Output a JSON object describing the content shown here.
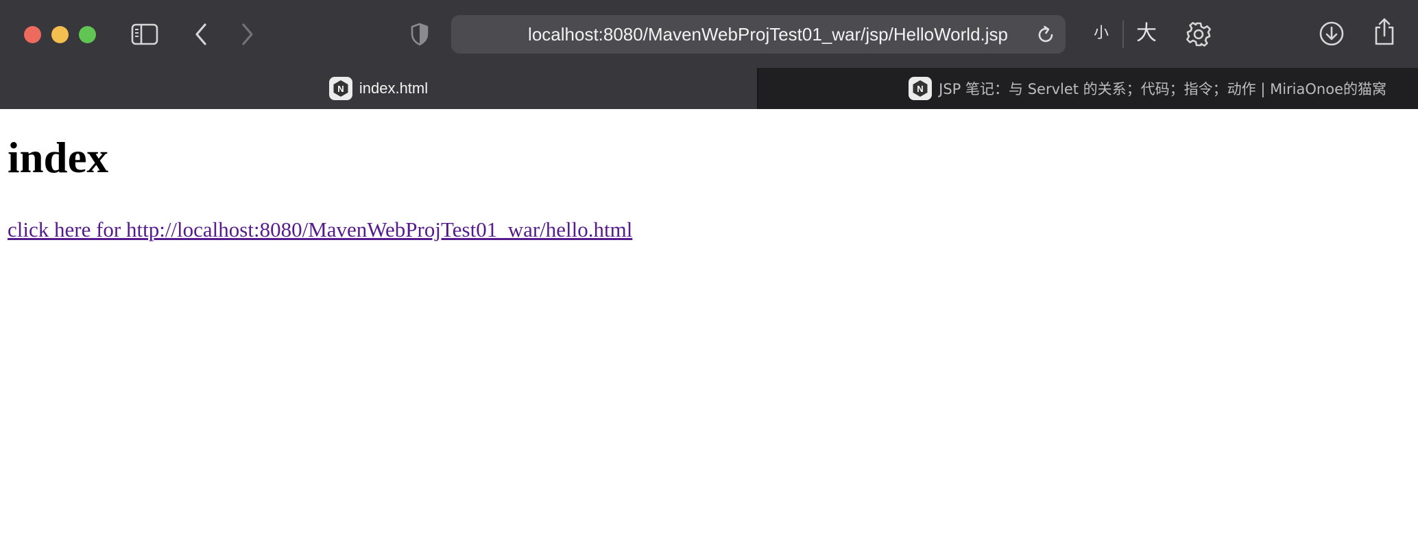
{
  "window": {
    "traffic_lights": [
      "close",
      "minimize",
      "zoom"
    ]
  },
  "toolbar": {
    "sidebar_icon": "sidebar-icon",
    "back_icon": "chevron-left-icon",
    "forward_icon": "chevron-right-icon",
    "privacy_icon": "shield-icon",
    "address": "localhost:8080/MavenWebProjTest01_war/jsp/HelloWorld.jsp",
    "reload_icon": "reload-icon",
    "zoom_small_label": "小",
    "zoom_large_label": "大",
    "settings_icon": "gear-icon",
    "download_icon": "download-icon",
    "share_icon": "share-icon"
  },
  "tabs": [
    {
      "label": "index.html",
      "favicon": "n-logo-icon",
      "active": true
    },
    {
      "label": "JSP 笔记：与 Servlet 的关系；代码；指令；动作 | MiriaOnoe的猫窝",
      "favicon": "n-logo-icon",
      "active": false
    }
  ],
  "page": {
    "heading": "index",
    "link_text": "click here for http://localhost:8080/MavenWebProjTest01_war/hello.html"
  },
  "colors": {
    "toolbar_bg": "#38383c",
    "tabbar_bg": "#222224",
    "link": "#551a8b",
    "close": "#ed6a5e",
    "minimize": "#f5bf4f",
    "zoom": "#61c554"
  }
}
